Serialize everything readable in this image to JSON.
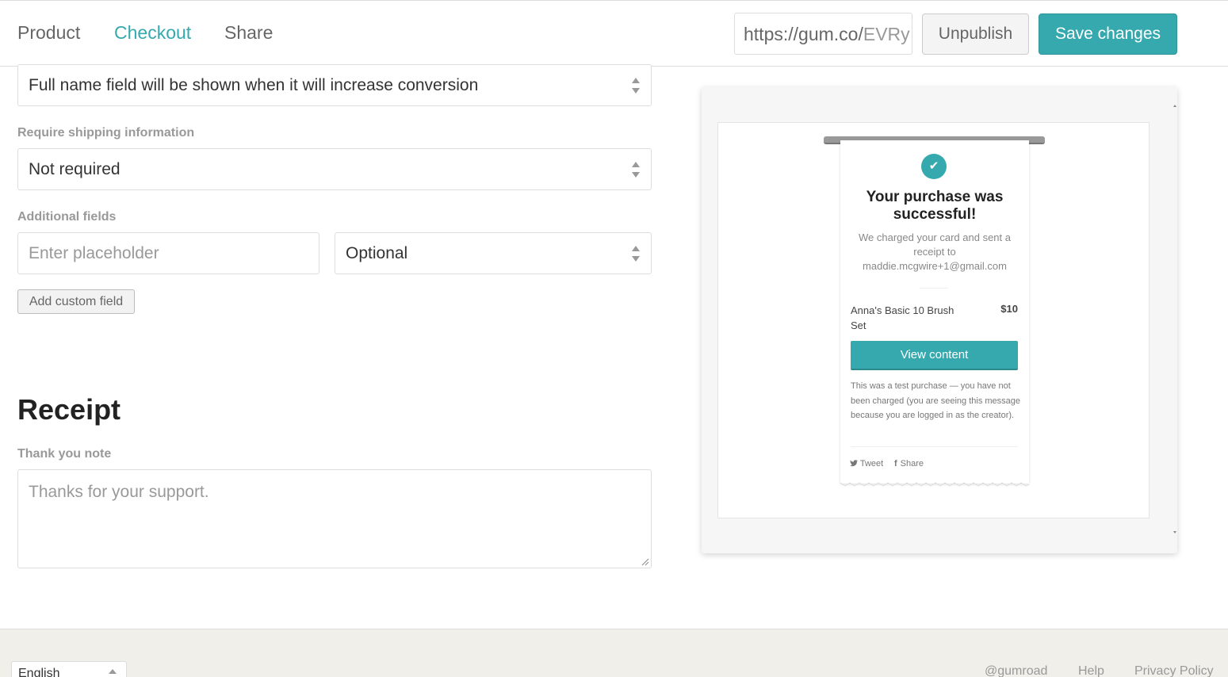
{
  "header": {
    "tabs": [
      "Product",
      "Checkout",
      "Share"
    ],
    "active_tab": "Checkout",
    "url_prefix": "https://gum.co/",
    "url_slug": "EVRy",
    "unpublish_label": "Unpublish",
    "save_label": "Save changes"
  },
  "form": {
    "full_name_select": "Full name field will be shown when it will increase conversion",
    "shipping_label": "Require shipping information",
    "shipping_select": "Not required",
    "additional_label": "Additional fields",
    "placeholder_input": "Enter placeholder",
    "optional_select": "Optional",
    "add_custom_field": "Add custom field",
    "receipt_heading": "Receipt",
    "thank_you_label": "Thank you note",
    "thank_you_placeholder": "Thanks for your support."
  },
  "preview": {
    "title": "Your purchase was successful!",
    "subtitle": "We charged your card and sent a receipt to maddie.mcgwire+1@gmail.com",
    "item_name": "Anna's Basic 10 Brush Set",
    "item_price": "$10",
    "view_content": "View content",
    "note": "This was a test purchase — you have not been charged (you are seeing this message because you are logged in as the creator).",
    "tweet": "Tweet",
    "share": "Share"
  },
  "footer": {
    "language": "English",
    "links": [
      "@gumroad",
      "Help",
      "Privacy Policy"
    ]
  },
  "colors": {
    "accent": "#36a9ae"
  }
}
